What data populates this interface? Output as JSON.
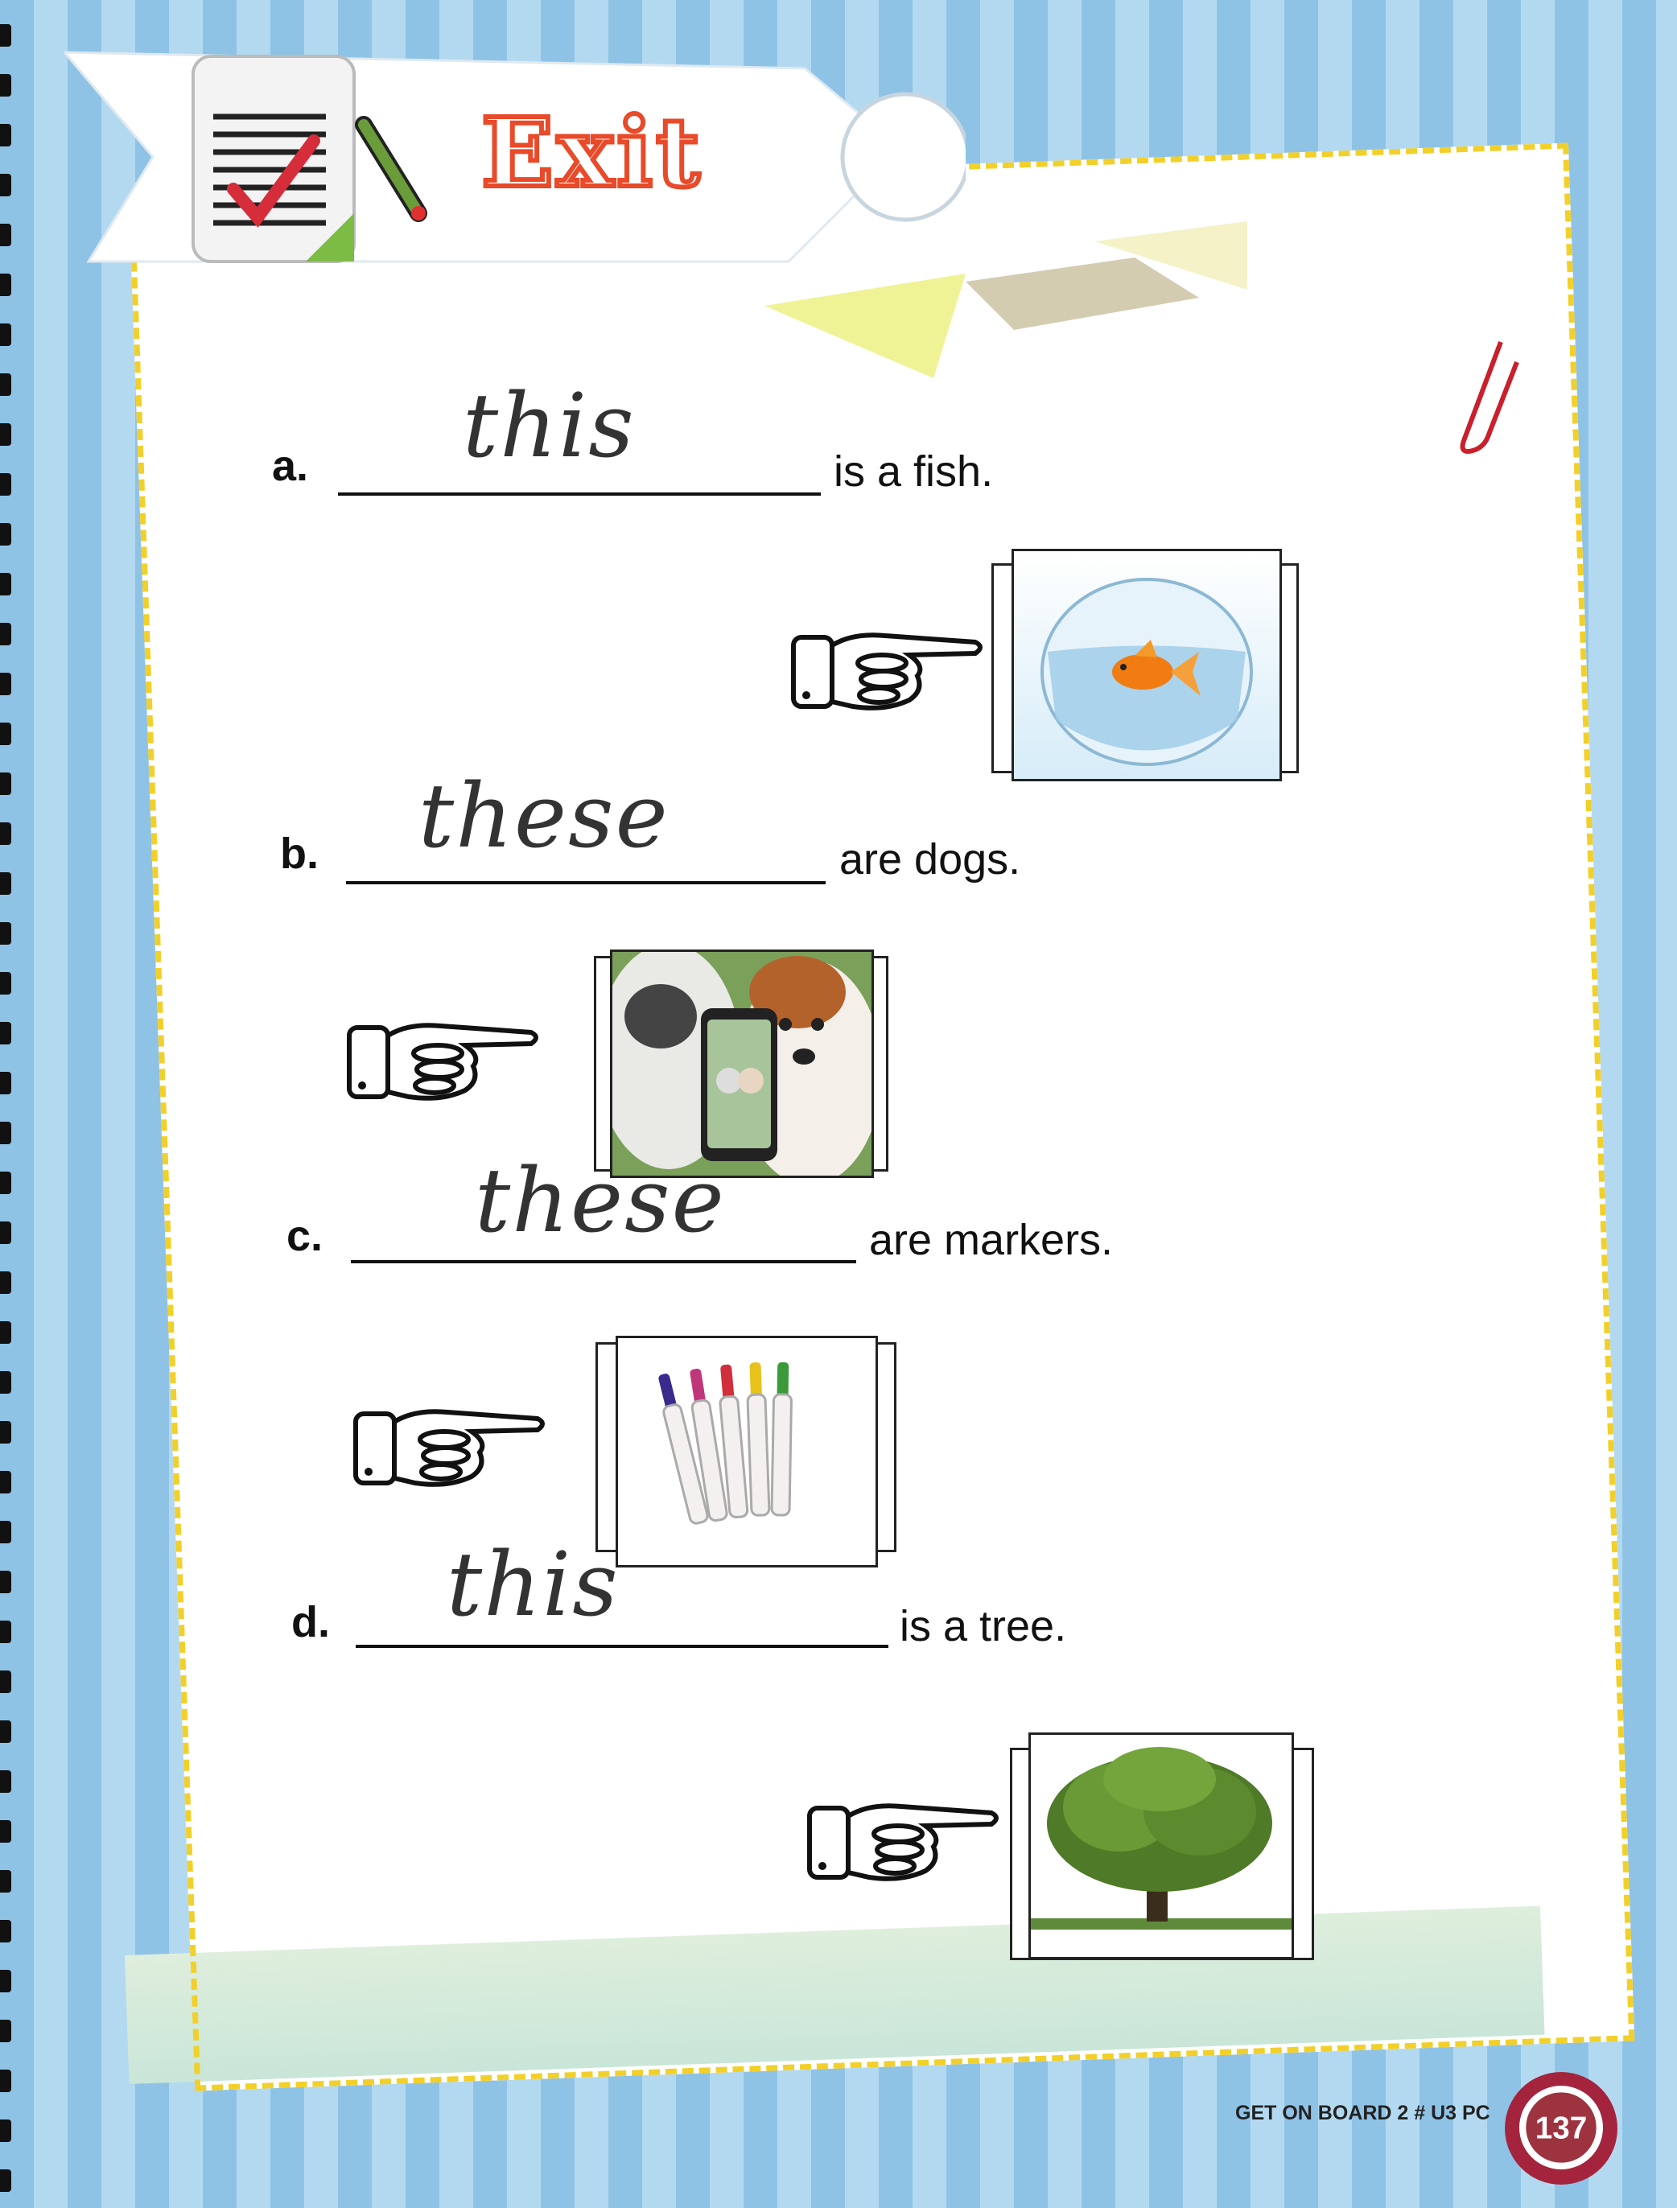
{
  "header": {
    "title": "Exit",
    "icon": "checklist-pencil-icon"
  },
  "exercises": [
    {
      "letter": "a.",
      "answer": "this",
      "rest": "is a fish.",
      "picture": "goldfish-bowl"
    },
    {
      "letter": "b.",
      "answer": "these",
      "rest": "are dogs.",
      "picture": "dogs-selfie"
    },
    {
      "letter": "c.",
      "answer": "these",
      "rest": "are markers.",
      "picture": "markers"
    },
    {
      "letter": "d.",
      "answer": "this",
      "rest": "is a tree.",
      "picture": "tree"
    }
  ],
  "footer": {
    "book": "GET ON BOARD 2 # U3 PC",
    "page": "137"
  },
  "colors": {
    "background_stripe_a": "#8fc3e6",
    "background_stripe_b": "#b3d9f0",
    "border": "#f2d02a",
    "title_red": "#e84a2a",
    "page_badge": "#a5243d"
  }
}
